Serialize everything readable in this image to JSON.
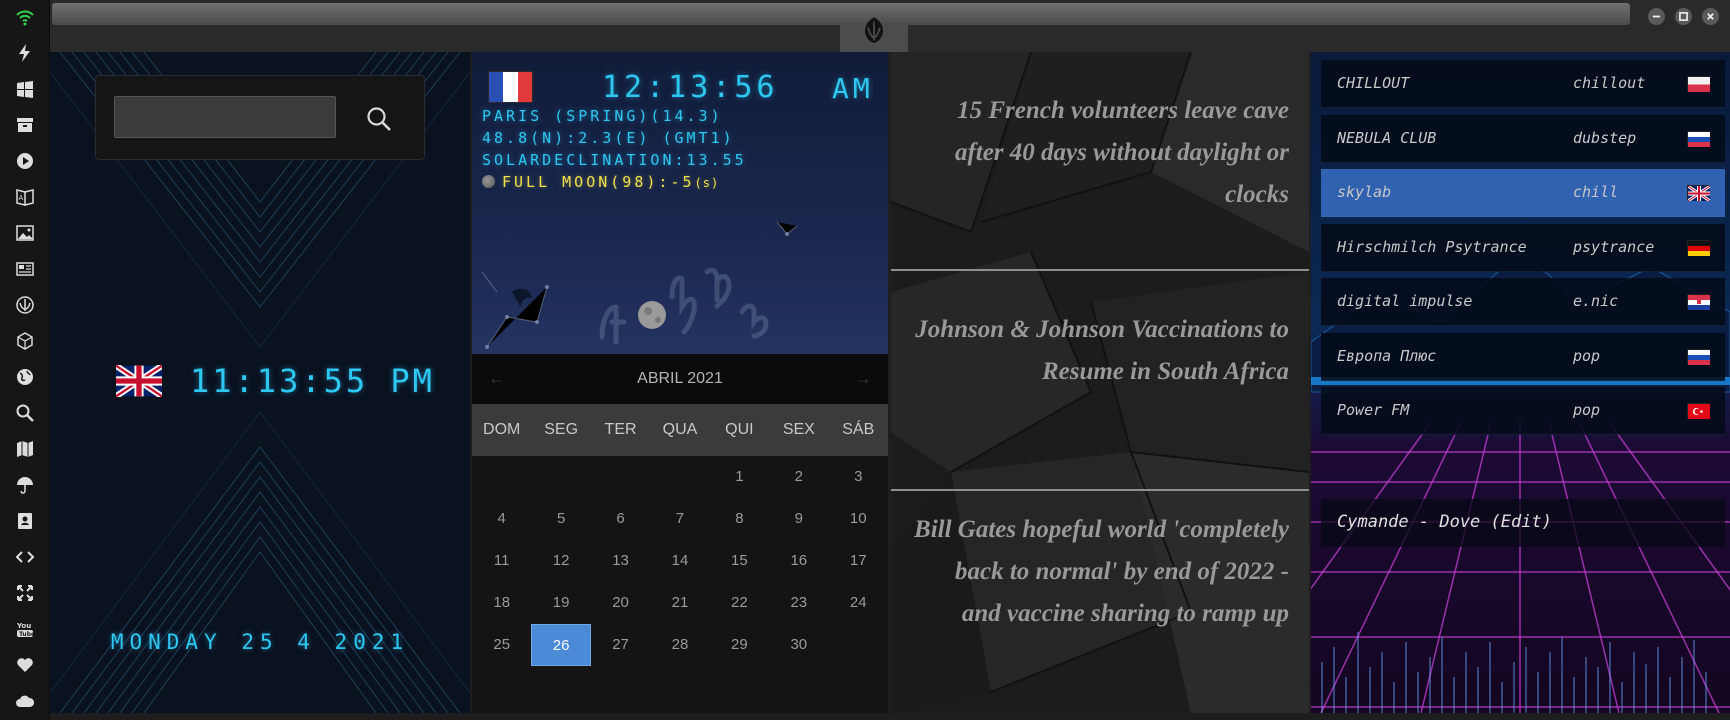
{
  "sidebar": {
    "items": [
      {
        "icon": "wifi-icon",
        "label": "Network"
      },
      {
        "icon": "lightning-icon",
        "label": "Power"
      },
      {
        "icon": "windows-icon",
        "label": "Windows"
      },
      {
        "icon": "archive-icon",
        "label": "Archive"
      },
      {
        "icon": "play-icon",
        "label": "Media"
      },
      {
        "icon": "translate-icon",
        "label": "Translate"
      },
      {
        "icon": "image-icon",
        "label": "Images"
      },
      {
        "icon": "news-icon",
        "label": "News"
      },
      {
        "icon": "rebel-icon",
        "label": "Rebel"
      },
      {
        "icon": "cube-icon",
        "label": "3D"
      },
      {
        "icon": "globe-icon",
        "label": "Globe"
      },
      {
        "icon": "search-icon",
        "label": "Search"
      },
      {
        "icon": "map-icon",
        "label": "Map"
      },
      {
        "icon": "umbrella-icon",
        "label": "Weather"
      },
      {
        "icon": "contacts-icon",
        "label": "Contacts"
      },
      {
        "icon": "code-icon",
        "label": "Code"
      },
      {
        "icon": "expand-icon",
        "label": "Expand"
      },
      {
        "icon": "youtube-icon",
        "label": "YouTube"
      },
      {
        "icon": "heart-icon",
        "label": "Favorites"
      },
      {
        "icon": "cloud-icon",
        "label": "Cloud"
      }
    ]
  },
  "titlebar": {
    "logo_icon": "rebel-alliance-icon"
  },
  "uk_panel": {
    "search_placeholder": "",
    "search_icon": "search-icon",
    "flag": "united-kingdom",
    "time": "11:13:55  PM",
    "date": "MONDAY 25 4 2021"
  },
  "weather": {
    "flag": "france",
    "time": "12:13:56",
    "ampm": "AM",
    "line1": "PARIS (SPRING)(14.3)",
    "line2": "48.8(N):2.3(E) (GMT1)",
    "line3": "SOLARDECLINATION:13.55",
    "moon": "FULL MOON(98):-5",
    "moon_unit": "(s)"
  },
  "calendar": {
    "title": "ABRIL 2021",
    "prev_label": "←",
    "next_label": "→",
    "day_names": [
      "DOM",
      "SEG",
      "TER",
      "QUA",
      "QUI",
      "SEX",
      "SÁB"
    ],
    "weeks": [
      [
        "",
        "",
        "",
        "",
        "1",
        "2",
        "3"
      ],
      [
        "4",
        "5",
        "6",
        "7",
        "8",
        "9",
        "10"
      ],
      [
        "11",
        "12",
        "13",
        "14",
        "15",
        "16",
        "17"
      ],
      [
        "18",
        "19",
        "20",
        "21",
        "22",
        "23",
        "24"
      ],
      [
        "25",
        "26",
        "27",
        "28",
        "29",
        "30",
        ""
      ]
    ],
    "selected": "26"
  },
  "news": {
    "items": [
      "15 French volunteers leave cave after 40 days without daylight or clocks",
      "Johnson & Johnson Vaccinations to Resume in South Africa",
      "Bill Gates hopeful world 'completely back to normal' by end of 2022 - and vaccine sharing to ramp up"
    ]
  },
  "radio": {
    "stations": [
      {
        "name": "CHILLOUT",
        "genre": "chillout",
        "flag": "poland"
      },
      {
        "name": "NEBULA CLUB",
        "genre": "dubstep",
        "flag": "russia"
      },
      {
        "name": "skylab",
        "genre": "chill",
        "flag": "united-kingdom",
        "active": true
      },
      {
        "name": "Hirschmilch Psytrance",
        "genre": "psytrance",
        "flag": "germany"
      },
      {
        "name": "digital impulse",
        "genre": "e.nic",
        "flag": "croatia"
      },
      {
        "name": "Европа Плюс",
        "genre": "pop",
        "flag": "russia"
      },
      {
        "name": "Power FM",
        "genre": "pop",
        "flag": "turkey"
      }
    ],
    "now_playing": "Cymande - Dove (Edit)"
  },
  "colors": {
    "lcd_cyan": "#2ec7f0",
    "moon_yellow": "#f0e04a",
    "selection_blue": "#4a8ad6",
    "wifi_green": "#34d24a"
  }
}
